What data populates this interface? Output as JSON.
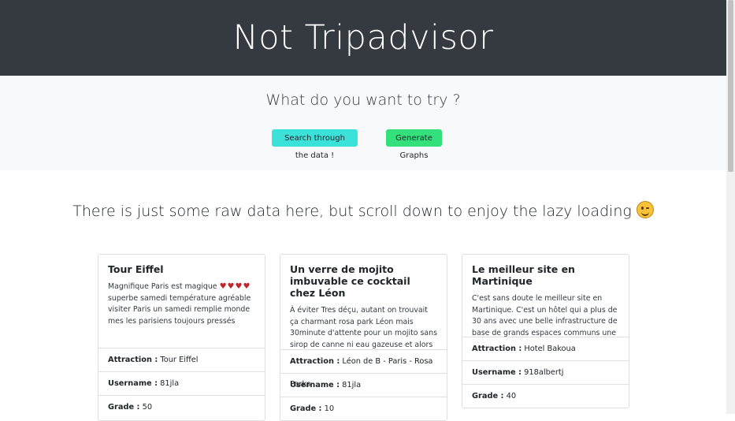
{
  "header": {
    "title": "Not Tripadvisor"
  },
  "hero": {
    "question": "What do you want to try ?",
    "search_button": "Search through the data !",
    "graphs_button": "Generate Graphs"
  },
  "lazy_text": "There is just some raw data here, but scroll down to enjoy the lazy loading",
  "labels": {
    "attraction": "Attraction :",
    "username": "Username :",
    "grade": "Grade :"
  },
  "cards": [
    {
      "title": "Tour Eiffel",
      "text": "Magnifique Paris est magique",
      "hearts": "♥♥♥♥",
      "text2": "superbe samedi température agréable visiter Paris un samedi remplie monde mes les parisiens toujours pressés même le week",
      "attraction": "Tour Eiffel",
      "username": "81jla",
      "grade": "50"
    },
    {
      "title": "Un verre de mojito imbuvable ce cocktail chez Léon",
      "text": "À éviter Tres déçu, autant on trouvait ça charmant rosa park Léon mais 30minute d'attente pour un mojito sans sirop de canne ni eau gazeuse et alors zéro rhu",
      "attraction": "Léon de B - Paris - Rosa Parks",
      "username": "81jla",
      "grade": "10"
    },
    {
      "title": "Le meilleur site en Martinique",
      "text": "C'est sans doute le meilleur site en Martinique. C'est un hôtel qui a plus de 30 ans avec une belle infrastructure de base de grands espaces communs une conserv",
      "attraction": "Hotel Bakoua",
      "username": "918albertj",
      "grade": "40"
    }
  ]
}
